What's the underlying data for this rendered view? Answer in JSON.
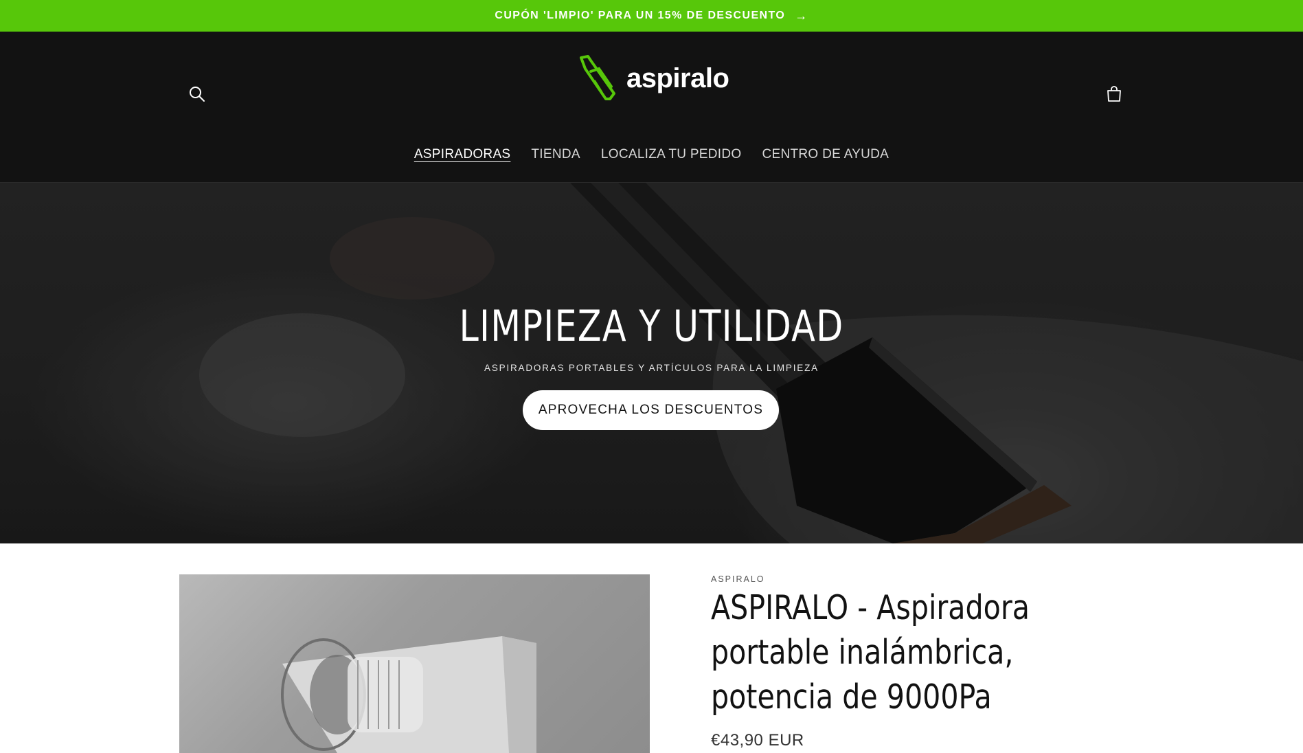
{
  "announcement": {
    "text": "CUPÓN 'LIMPIO' PARA UN 15% DE DESCUENTO",
    "arrow": "→",
    "bg_color": "#57c70a"
  },
  "header": {
    "logo_text": "aspiralo",
    "search_icon": "search-icon",
    "cart_icon": "cart-icon",
    "nav": [
      {
        "label": "ASPIRADORAS",
        "active": true
      },
      {
        "label": "TIENDA",
        "active": false
      },
      {
        "label": "LOCALIZA TU PEDIDO",
        "active": false
      },
      {
        "label": "CENTRO DE AYUDA",
        "active": false
      }
    ]
  },
  "hero": {
    "title": "LIMPIEZA Y UTILIDAD",
    "subtitle": "ASPIRADORAS PORTABLES Y ARTÍCULOS PARA LA LIMPIEZA",
    "button_label": "APROVECHA LOS DESCUENTOS"
  },
  "product": {
    "vendor": "ASPIRALO",
    "title": "ASPIRALO - Aspiradora portable inalámbrica, potencia de 9000Pa",
    "price": "€43,90 EUR"
  },
  "colors": {
    "accent_green": "#57c70a",
    "header_bg": "#121212"
  }
}
